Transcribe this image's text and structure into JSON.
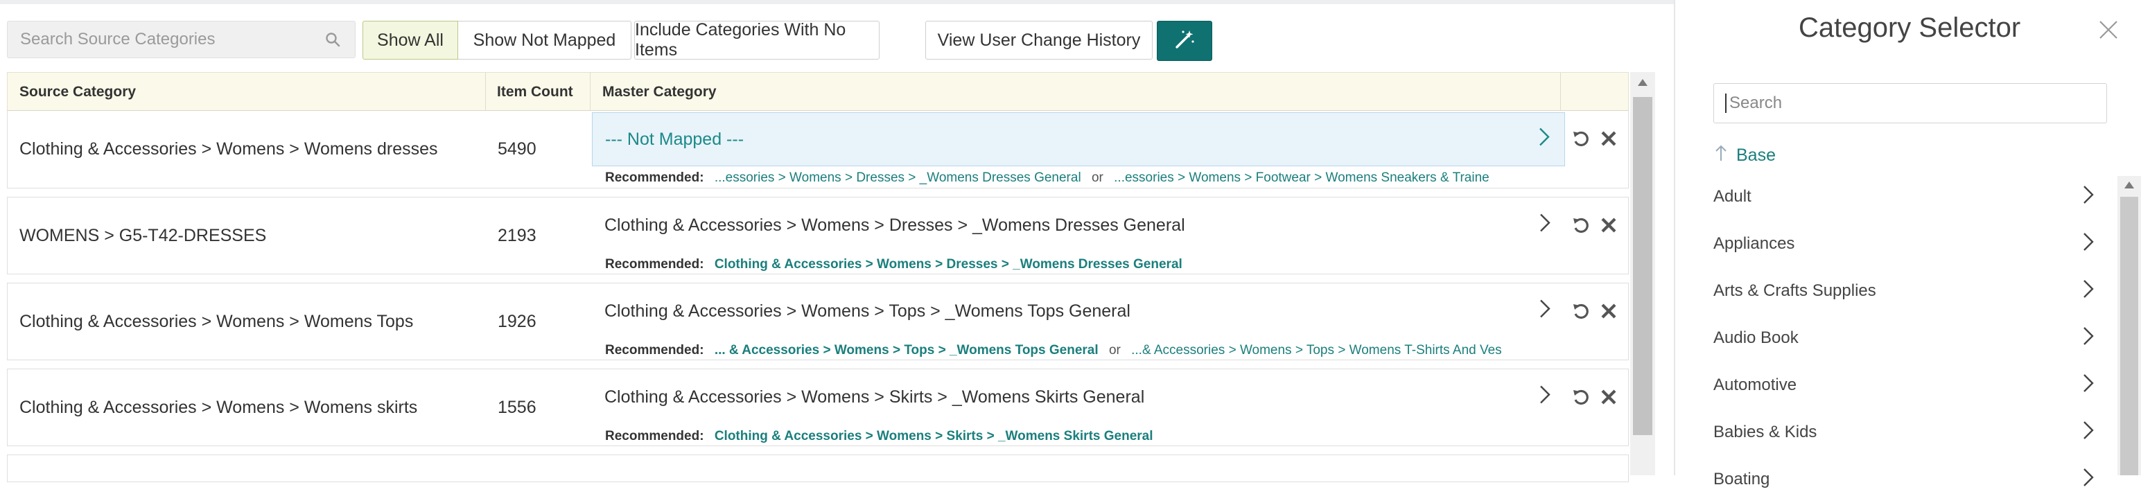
{
  "toolbar": {
    "search_placeholder": "Search Source Categories",
    "show_all": "Show All",
    "show_not_mapped": "Show Not Mapped",
    "include_no_items": "Include Categories With No Items",
    "view_history": "View User Change History",
    "accent_color": "#0f7170",
    "icons": {
      "search": "search-icon",
      "wand": "magic-wand-icon"
    }
  },
  "table": {
    "headers": {
      "source": "Source Category",
      "count": "Item Count",
      "master": "Master Category"
    },
    "rec_label": "Recommended:",
    "or_label": "or",
    "rows": [
      {
        "source": "Clothing & Accessories > Womens > Womens dresses",
        "count": "5490",
        "master": "--- Not Mapped ---",
        "rec1": "...essories > Womens > Dresses > _Womens Dresses General",
        "rec2": "...essories > Womens > Footwear > Womens Sneakers & Traine"
      },
      {
        "source": "WOMENS > G5-T42-DRESSES",
        "count": "2193",
        "master": "Clothing & Accessories > Womens > Dresses > _Womens Dresses General",
        "rec1": "Clothing & Accessories > Womens > Dresses > _Womens Dresses General"
      },
      {
        "source": "Clothing & Accessories > Womens > Womens Tops",
        "count": "1926",
        "master": "Clothing & Accessories > Womens > Tops > _Womens Tops General",
        "rec1": "... & Accessories > Womens > Tops > _Womens Tops General",
        "rec2": "...& Accessories > Womens > Tops > Womens T-Shirts And Ves"
      },
      {
        "source": "Clothing & Accessories > Womens > Womens skirts",
        "count": "1556",
        "master": "Clothing & Accessories > Womens > Skirts > _Womens Skirts General",
        "rec1": "Clothing & Accessories > Womens > Skirts > _Womens Skirts General"
      }
    ]
  },
  "panel": {
    "title": "Category Selector",
    "search_placeholder": "Search",
    "base_label": "Base",
    "categories": [
      "Adult",
      "Appliances",
      "Arts & Crafts Supplies",
      "Audio Book",
      "Automotive",
      "Babies & Kids",
      "Boating"
    ]
  }
}
